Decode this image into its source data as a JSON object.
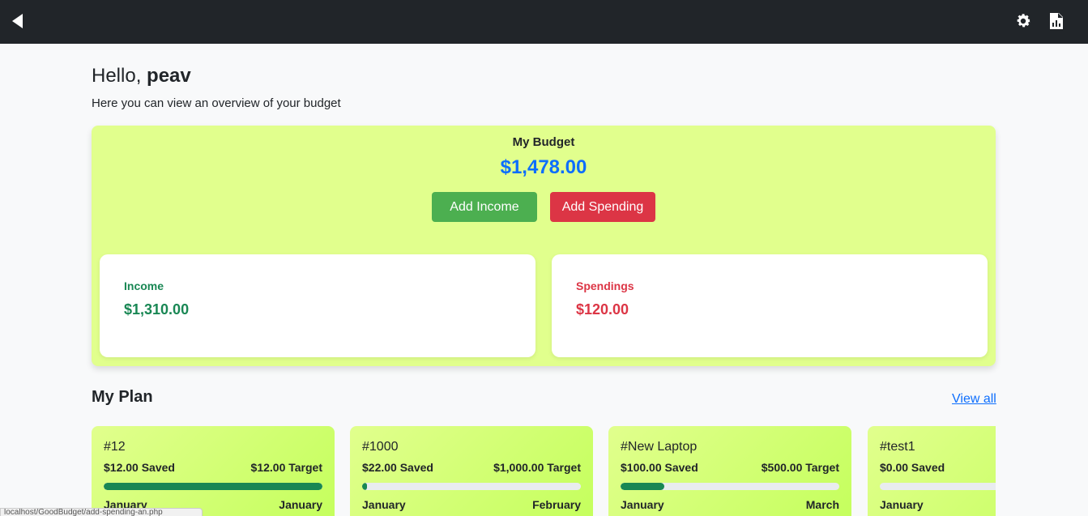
{
  "topbar": {
    "icons": [
      "back-arrow-icon",
      "gear-icon",
      "report-icon"
    ]
  },
  "greeting": {
    "prefix": "Hello, ",
    "username": "peav",
    "subtitle": "Here you can view an overview of your budget"
  },
  "budget": {
    "title": "My Budget",
    "amount": "$1,478.00",
    "add_income_label": "Add Income",
    "add_spending_label": "Add Spending",
    "income_label": "Income",
    "income_value": "$1,310.00",
    "spending_label": "Spendings",
    "spending_value": "$120.00"
  },
  "plan": {
    "title": "My Plan",
    "view_all": "View all",
    "items": [
      {
        "name": "#12",
        "saved": "$12.00 Saved",
        "target": "$12.00 Target",
        "progress": 1.0,
        "start": "January",
        "end": "January"
      },
      {
        "name": "#1000",
        "saved": "$22.00 Saved",
        "target": "$1,000.00 Target",
        "progress": 0.022,
        "start": "January",
        "end": "February"
      },
      {
        "name": "#New Laptop",
        "saved": "$100.00 Saved",
        "target": "$500.00 Target",
        "progress": 0.2,
        "start": "January",
        "end": "March"
      },
      {
        "name": "#test1",
        "saved": "$0.00 Saved",
        "target": "",
        "progress": 0,
        "start": "January",
        "end": ""
      }
    ]
  },
  "statusbar": {
    "url": "localhost/GoodBudget/add-spending-an.php"
  },
  "colors": {
    "topbar": "#212529",
    "budget_card": "#e1ff8d",
    "income_button": "#4caf50",
    "spending_button": "#dc3545",
    "accent_blue": "#0d6efd",
    "income_text": "#198754",
    "spending_text": "#dc3545"
  }
}
